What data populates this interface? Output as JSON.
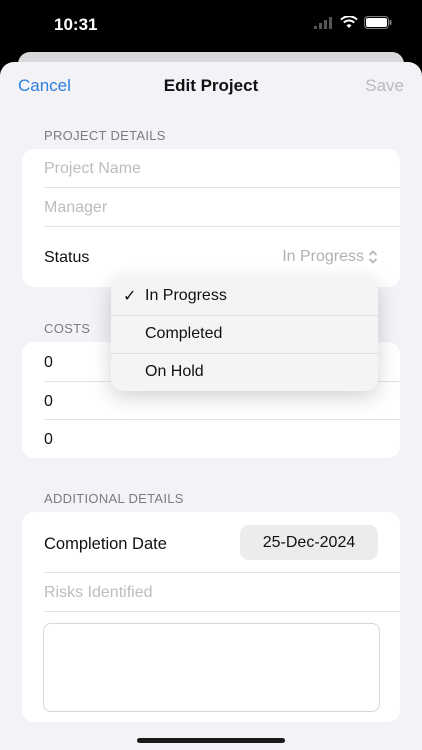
{
  "status_bar": {
    "time": "10:31"
  },
  "nav": {
    "cancel": "Cancel",
    "title": "Edit Project",
    "save": "Save"
  },
  "project_details": {
    "header": "PROJECT DETAILS",
    "name_placeholder": "Project Name",
    "manager_placeholder": "Manager",
    "status_label": "Status",
    "status_value": "In Progress"
  },
  "costs": {
    "header": "COSTS",
    "values": [
      "0",
      "0",
      "0"
    ]
  },
  "status_menu": {
    "options": [
      "In Progress",
      "Completed",
      "On Hold"
    ],
    "selected": "In Progress"
  },
  "additional_details": {
    "header": "ADDITIONAL DETAILS",
    "completion_label": "Completion Date",
    "completion_value": "25-Dec-2024",
    "risks_placeholder": "Risks Identified"
  },
  "colors": {
    "accent": "#2d7fe0",
    "background": "#f2f2f7"
  }
}
